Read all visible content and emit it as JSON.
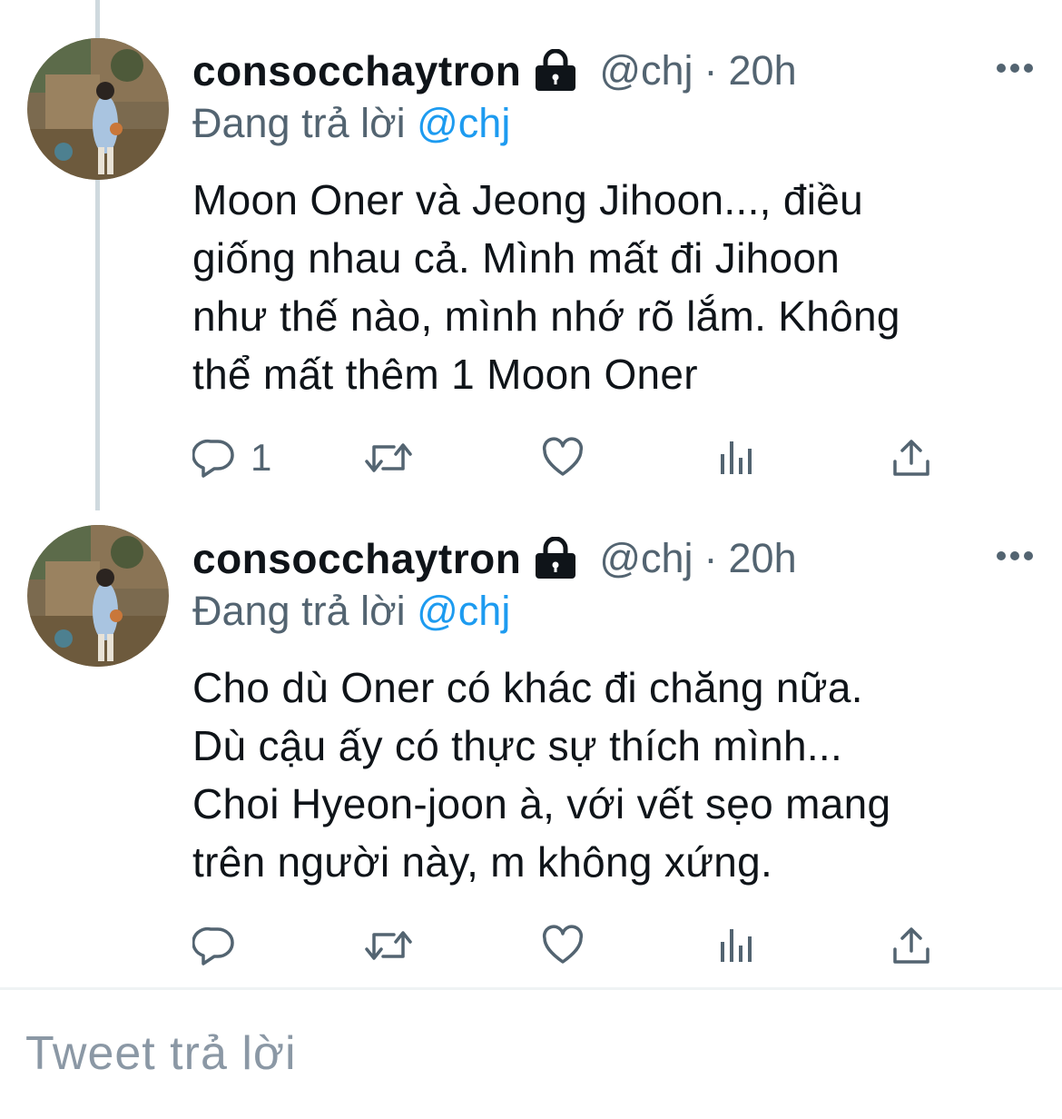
{
  "tweets": [
    {
      "display_name": "consocchaytron",
      "handle": "@chj",
      "separator": "·",
      "time": "20h",
      "replying_prefix": "Đang trả lời",
      "replying_to": "@chj",
      "lines": [
        "Moon Oner và Jeong Jihoon..., điều",
        "giống nhau cả. Mình mất đi Jihoon",
        "như thế nào, mình nhớ rõ lắm. Không",
        "thể mất thêm 1 Moon Oner"
      ],
      "reply_count": "1"
    },
    {
      "display_name": "consocchaytron",
      "handle": "@chj",
      "separator": "·",
      "time": "20h",
      "replying_prefix": "Đang trả lời",
      "replying_to": "@chj",
      "lines": [
        "Cho dù Oner có khác đi chăng nữa.",
        "Dù cậu ấy có thực sự thích mình...",
        "Choi Hyeon-joon à, với vết sẹo mang",
        "trên người này, m không xứng."
      ],
      "reply_count": ""
    }
  ],
  "reply_box": {
    "placeholder": "Tweet trả lời"
  },
  "icons": [
    "lock-icon",
    "more-icon",
    "reply-icon",
    "retweet-icon",
    "like-icon",
    "analytics-icon",
    "share-icon"
  ],
  "colors": {
    "text": "#0f1419",
    "secondary": "#536471",
    "accent": "#1d9bf0",
    "thread_line": "#cfd9de"
  }
}
